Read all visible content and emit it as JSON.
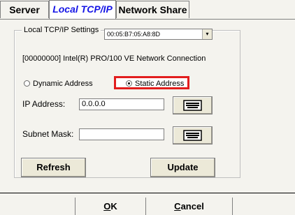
{
  "tabs": {
    "server": "Server",
    "local": "Local TCP/IP",
    "share": "Network Share"
  },
  "group": {
    "legend": "Local TCP/IP Settings",
    "mac_value": "00:05:B7:05:A8:8D",
    "connection": "[00000000] Intel(R) PRO/100 VE Network Connection"
  },
  "address_mode": {
    "dynamic_label": "Dynamic Address",
    "static_label": "Static Address",
    "selected": "static"
  },
  "fields": {
    "ip_label": "IP Address:",
    "ip_value": "0.0.0.0",
    "mask_label": "Subnet Mask:",
    "mask_value": ""
  },
  "buttons": {
    "refresh": "Refresh",
    "update": "Update",
    "ok_accel": "O",
    "ok_rest": "K",
    "cancel_accel": "C",
    "cancel_rest": "ancel"
  },
  "colors": {
    "active_tab": "#1515e6",
    "highlight": "#e21d1d"
  },
  "icons": {
    "keyboard": "keyboard-icon",
    "dropdown": "chevron-down-icon"
  }
}
